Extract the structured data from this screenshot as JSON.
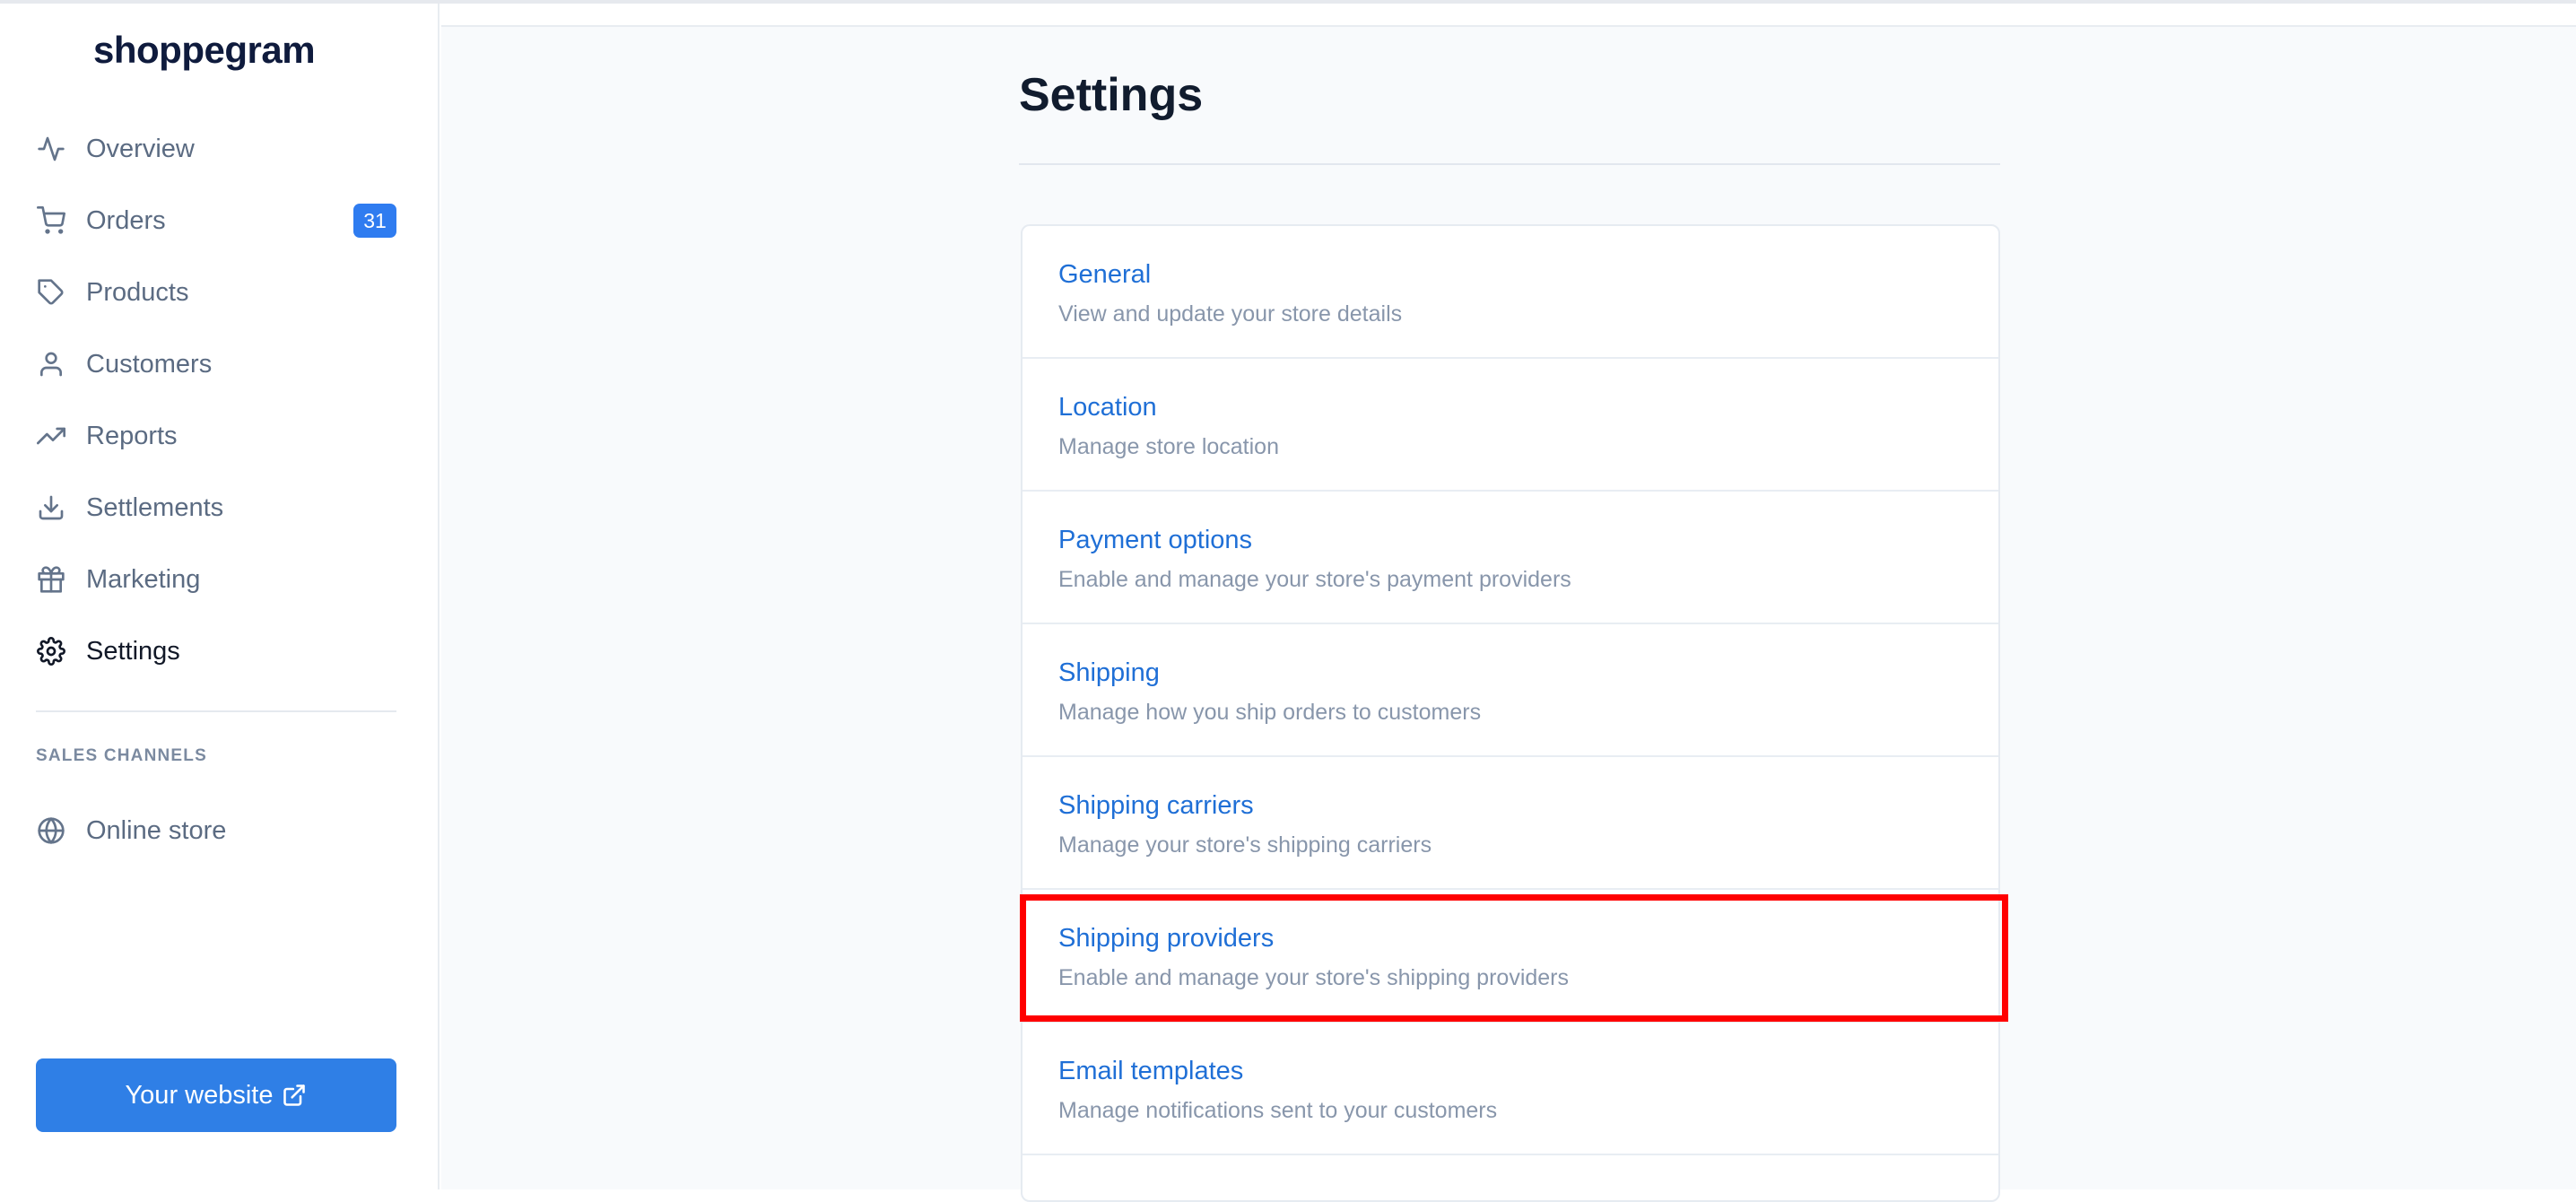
{
  "app": {
    "logo_text": "shoppegram"
  },
  "sidebar": {
    "items": [
      {
        "label": "Overview",
        "icon": "activity-icon"
      },
      {
        "label": "Orders",
        "icon": "cart-icon",
        "badge": "31"
      },
      {
        "label": "Products",
        "icon": "tag-icon"
      },
      {
        "label": "Customers",
        "icon": "user-icon"
      },
      {
        "label": "Reports",
        "icon": "trending-up-icon"
      },
      {
        "label": "Settlements",
        "icon": "download-icon"
      },
      {
        "label": "Marketing",
        "icon": "gift-icon"
      },
      {
        "label": "Settings",
        "icon": "gear-icon",
        "active": true
      }
    ],
    "section_label": "SALES CHANNELS",
    "channels": [
      {
        "label": "Online store",
        "icon": "globe-icon"
      }
    ],
    "website_button": "Your website"
  },
  "main": {
    "title": "Settings",
    "settings": [
      {
        "title": "General",
        "description": "View and update your store details"
      },
      {
        "title": "Location",
        "description": "Manage store location"
      },
      {
        "title": "Payment options",
        "description": "Enable and manage your store's payment providers"
      },
      {
        "title": "Shipping",
        "description": "Manage how you ship orders to customers"
      },
      {
        "title": "Shipping carriers",
        "description": "Manage your store's shipping carriers"
      },
      {
        "title": "Shipping providers",
        "description": "Enable and manage your store's shipping providers",
        "highlighted": true
      },
      {
        "title": "Email templates",
        "description": "Manage notifications sent to your customers"
      }
    ]
  },
  "colors": {
    "accent": "#2f7fe6",
    "link": "#1f6fd6",
    "highlight": "#ff0000",
    "badge": "#2f7cf0"
  }
}
